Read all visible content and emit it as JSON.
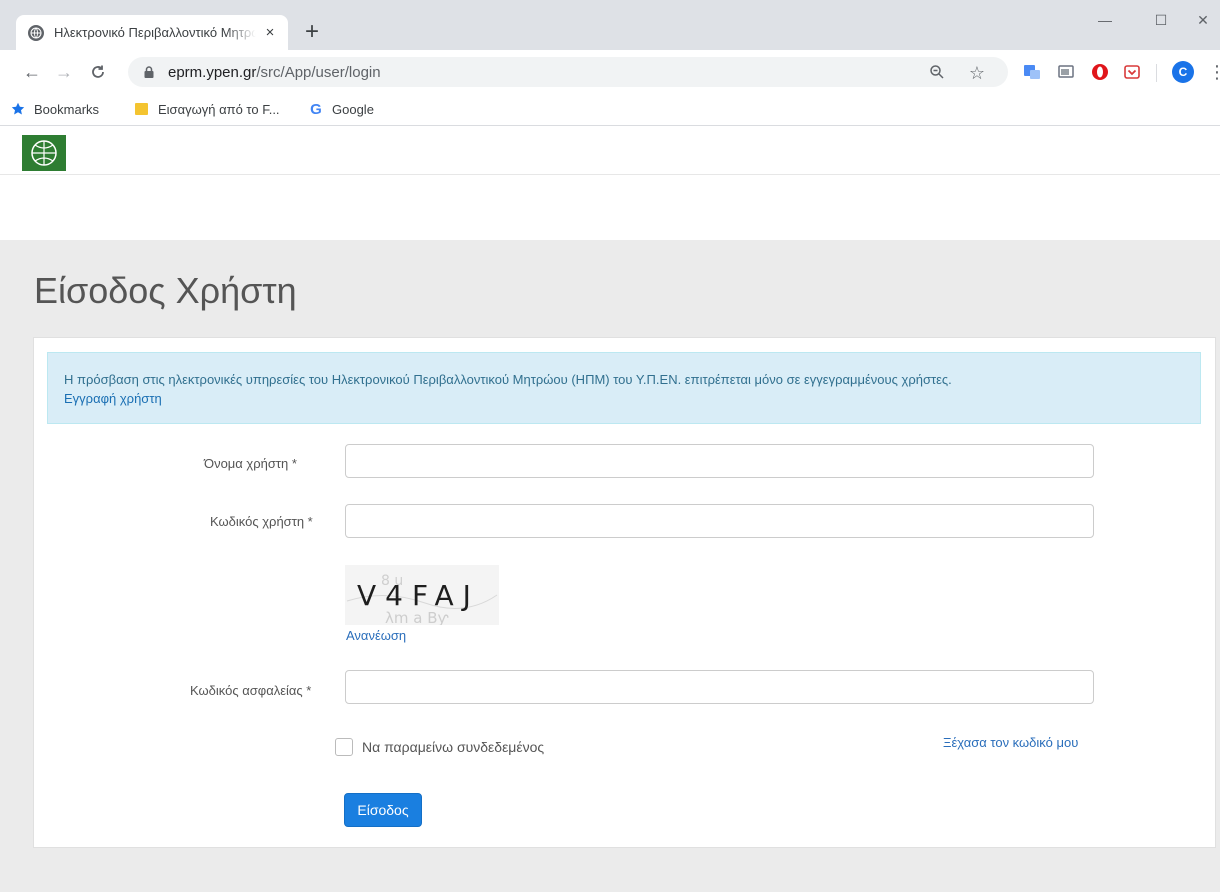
{
  "browser": {
    "tab": {
      "title": "Ηλεκτρονικό Περιβαλλοντικό Μητρώο",
      "close": "×"
    },
    "new_tab": "+",
    "window_controls": {
      "minimize": "—",
      "maximize": "☐",
      "close": "✕"
    },
    "address": {
      "domain": "eprm.ypen.gr",
      "path": "/src/App/user/login"
    },
    "avatar_initial": "C",
    "bookmarks": [
      {
        "label": "Bookmarks",
        "icon": "star-icon"
      },
      {
        "label": "Εισαγωγή από το F...",
        "icon": "folder-icon"
      },
      {
        "label": "Google",
        "icon": "google-icon"
      }
    ]
  },
  "page": {
    "title": "Είσοδος Χρήστη",
    "alert": {
      "text": "Η πρόσβαση στις ηλεκτρονικές υπηρεσίες του Ηλεκτρονικού Περιβαλλοντικού Μητρώου (ΗΠΜ) του Υ.Π.ΕΝ. επιτρέπεται μόνο σε εγγεγραμμένους χρήστες.",
      "link": "Εγγραφή χρήστη"
    },
    "form": {
      "username_label": "Όνομα χρήστη *",
      "username_value": "",
      "password_label": "Κωδικός χρήστη *",
      "password_value": "",
      "captcha_text": "V4FAJ",
      "captcha_refresh": "Ανανέωση",
      "security_label": "Κωδικός ασφαλείας *",
      "security_value": "",
      "remember_label": "Να παραμείνω συνδεδεμένος",
      "remember_checked": false,
      "forgot_link": "Ξέχασα τον κωδικό μου",
      "submit_label": "Είσοδος"
    }
  },
  "colors": {
    "accent": "#1a7fe0",
    "alert_bg": "#d9edf7",
    "alert_text": "#31708f",
    "link": "#2a6ebb",
    "page_bg": "#ebebeb"
  }
}
